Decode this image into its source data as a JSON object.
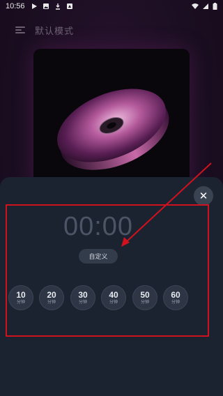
{
  "statusbar": {
    "time": "10:56",
    "left_icons": [
      "play-icon",
      "image-icon",
      "download-icon",
      "notification-icon"
    ],
    "right_icons": [
      "wifi-icon",
      "signal-icon",
      "battery-icon"
    ]
  },
  "header": {
    "title": "默认模式",
    "menu_icon": "menu-icon"
  },
  "timer_sheet": {
    "time_display": "00:00",
    "custom_label": "自定义",
    "close_icon": "close-icon",
    "close_glyph": "✕",
    "presets": [
      {
        "value": "10",
        "unit": "分钟"
      },
      {
        "value": "20",
        "unit": "分钟"
      },
      {
        "value": "30",
        "unit": "分钟"
      },
      {
        "value": "40",
        "unit": "分钟"
      },
      {
        "value": "50",
        "unit": "分钟"
      },
      {
        "value": "60",
        "unit": "分钟"
      }
    ]
  },
  "colors": {
    "annotation": "#d0121e",
    "sheet_bg": "#1b2331",
    "timer_text": "#4b5566"
  }
}
